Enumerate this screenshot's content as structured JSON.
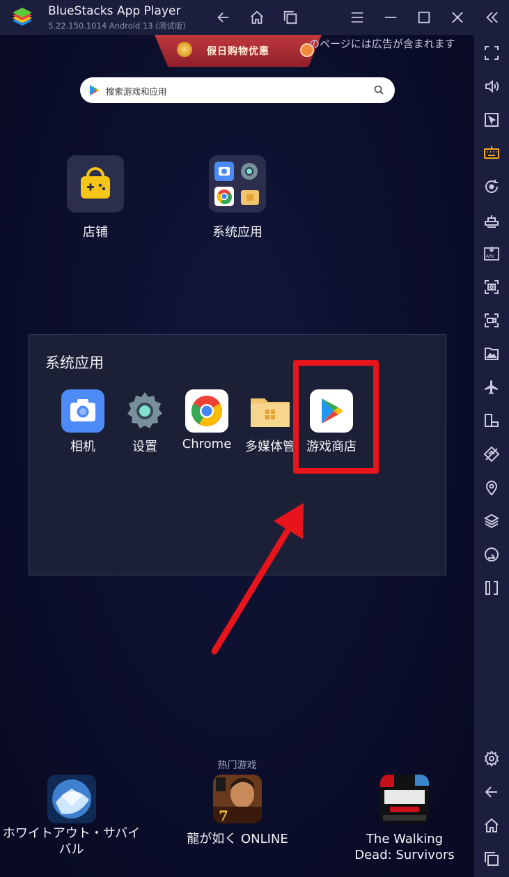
{
  "window": {
    "title": "BlueStacks App Player",
    "version": "5.22.150.1014  Android 13 (测试版)"
  },
  "ad": {
    "banner_text": "假日购物优惠",
    "notice": "のページには広告が含まれます"
  },
  "search": {
    "placeholder": "搜索游戏和应用"
  },
  "home_icons": [
    {
      "label": "店铺",
      "icon": "store-bag-icon"
    },
    {
      "label": "系统应用",
      "icon": "system-apps-folder-icon"
    }
  ],
  "folder": {
    "title": "系统应用",
    "apps": [
      {
        "label": "相机",
        "icon": "camera-icon"
      },
      {
        "label": "设置",
        "icon": "settings-gear-icon"
      },
      {
        "label": "Chrome",
        "icon": "chrome-icon"
      },
      {
        "label": "多媒体管",
        "icon": "media-manager-folder-icon"
      },
      {
        "label": "游戏商店",
        "icon": "google-play-icon"
      }
    ]
  },
  "hot_games": {
    "title": "热门游戏",
    "items": [
      {
        "label": "ホワイトアウト・サバイバル"
      },
      {
        "label": "龍が如く ONLINE"
      },
      {
        "label": "The Walking Dead: Survivors"
      }
    ]
  },
  "sidebar_tools": [
    "fullscreen-icon",
    "volume-icon",
    "pointer-icon",
    "keyboard-icon",
    "rotate-icon",
    "macro-icon",
    "apk-install-icon",
    "screenshot-icon",
    "record-icon",
    "media-folder-icon",
    "airplane-mode-icon",
    "multi-instance-icon",
    "eco-mode-icon",
    "location-icon",
    "layers-icon",
    "performance-icon",
    "sidebar-collapse-icon",
    "settings-icon",
    "back-icon",
    "home-icon",
    "recent-apps-icon"
  ],
  "colors": {
    "background": "#0b0e2a",
    "titlebar": "#1b1f3d",
    "folder_panel": "#1c2036",
    "highlight": "#e8141b",
    "toolbar_accent": "#f5a623"
  }
}
